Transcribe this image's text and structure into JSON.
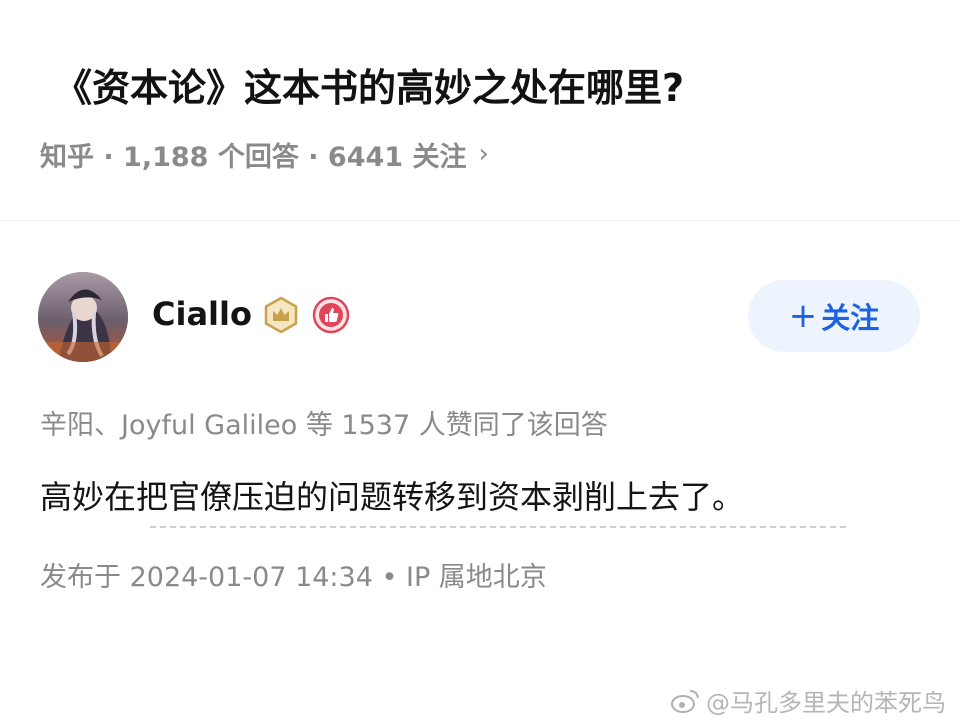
{
  "question": {
    "title": "《资本论》这本书的高妙之处在哪里?",
    "meta": "知乎 · 1,188 个回答 · 6441 关注",
    "chevron": "›"
  },
  "author": {
    "name": "Ciallo",
    "avatar_icon": "avatar-image",
    "badges": [
      "crown-badge-icon",
      "thumbs-up-badge-icon"
    ],
    "follow_plus": "+",
    "follow_label": "关注"
  },
  "answer": {
    "voters": "辛阳、Joyful Galileo 等 1537 人赞同了该回答",
    "content": "高妙在把官僚压迫的问题转移到资本剥削上去了。",
    "published": "发布于 2024-01-07 14:34 • IP 属地北京"
  },
  "watermark": {
    "text": "@马孔多里夫的苯死鸟"
  },
  "colors": {
    "accent": "#1b63e2",
    "follow_bg": "#eef4fd",
    "muted": "#8a8a8a",
    "badge_gold": "#c9a14a",
    "badge_red": "#e0465a"
  }
}
